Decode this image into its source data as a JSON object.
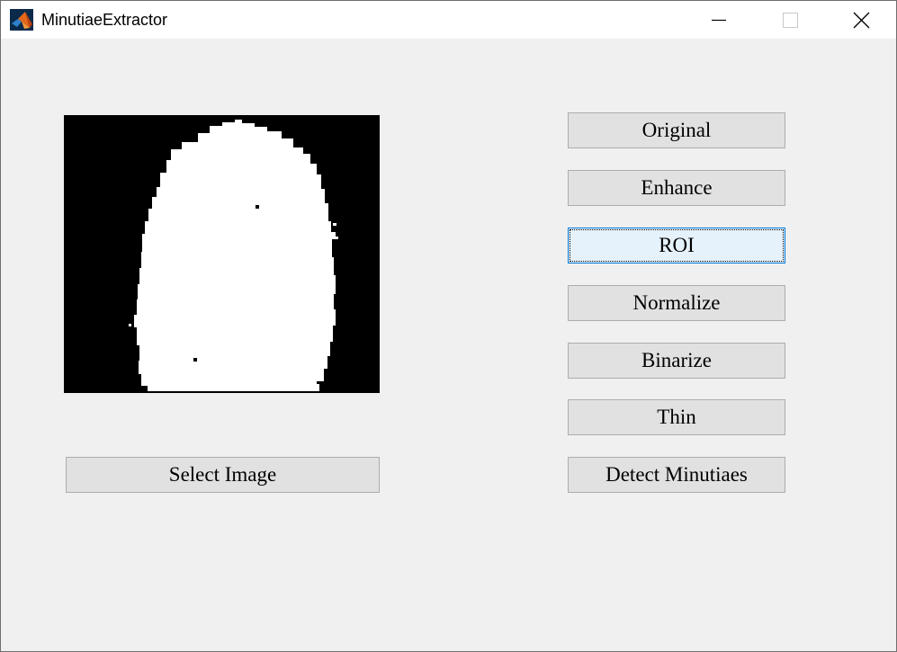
{
  "window": {
    "title": "MinutiaeExtractor",
    "app_icon": "matlab-icon",
    "controls": {
      "minimize_icon": "minimize-icon",
      "maximize_icon": "maximize-icon",
      "close_icon": "close-icon"
    }
  },
  "image_panel": {
    "description_icon": "roi-mask-image"
  },
  "buttons": {
    "original": "Original",
    "enhance": "Enhance",
    "roi": "ROI",
    "normalize": "Normalize",
    "binarize": "Binarize",
    "thin": "Thin",
    "detect_minutiaes": "Detect Minutiaes",
    "select_image": "Select Image"
  },
  "focused_button": "roi",
  "colors": {
    "window_bg": "#f0f0f0",
    "button_bg": "#e1e1e1",
    "button_border": "#adadad",
    "focused_bg": "#e5f1fb",
    "focused_border": "#0078d7"
  }
}
